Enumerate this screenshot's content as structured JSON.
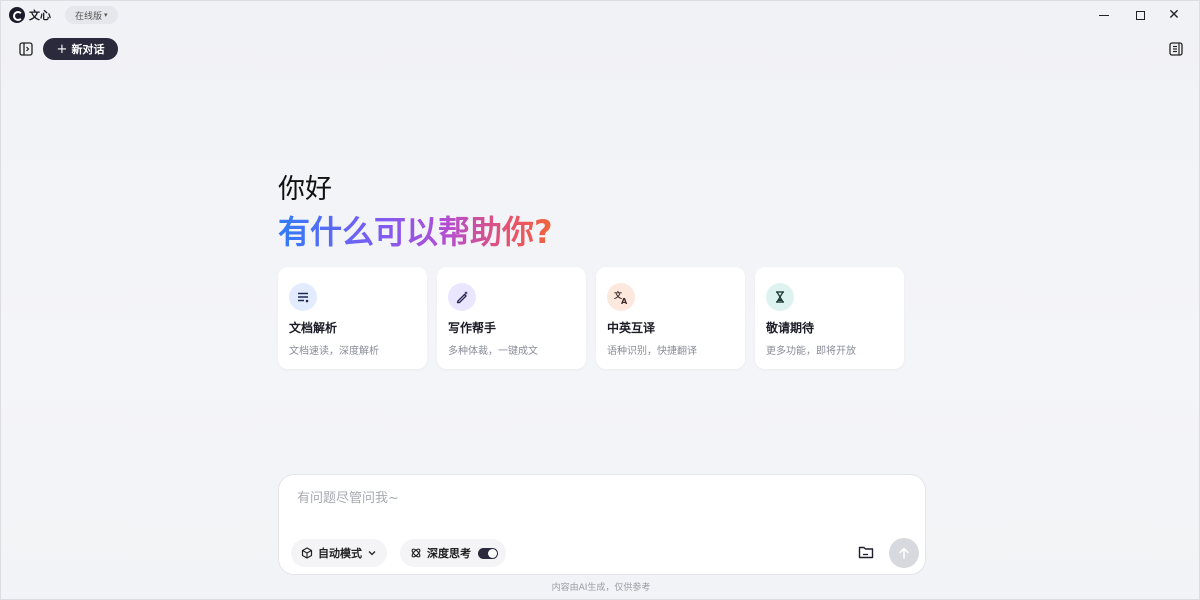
{
  "titlebar": {
    "app_name": "文心",
    "version_label": "在线版",
    "version_caret": "▾",
    "close_glyph": "✕"
  },
  "toolbar": {
    "new_chat_label": "新对话",
    "new_chat_plus": "+"
  },
  "greeting": {
    "hello": "你好",
    "question": "有什么可以帮助你?"
  },
  "cards": [
    {
      "title": "文档解析",
      "subtitle": "文档速读，深度解析",
      "icon": "document-lines-icon",
      "badge_color": "#e3ebff"
    },
    {
      "title": "写作帮手",
      "subtitle": "多种体裁，一键成文",
      "icon": "pen-sparkle-icon",
      "badge_color": "#ebe6ff"
    },
    {
      "title": "中英互译",
      "subtitle": "语种识别，快捷翻译",
      "icon": "translate-icon",
      "badge_color": "#fde8de"
    },
    {
      "title": "敬请期待",
      "subtitle": "更多功能，即将开放",
      "icon": "hourglass-icon",
      "badge_color": "#def3ef"
    }
  ],
  "composer": {
    "placeholder": "有问题尽管问我~",
    "mode_label": "自动模式",
    "deep_think_label": "深度思考",
    "deep_think_enabled": true
  },
  "footer": {
    "disclaimer": "内容由AI生成，仅供参考"
  }
}
